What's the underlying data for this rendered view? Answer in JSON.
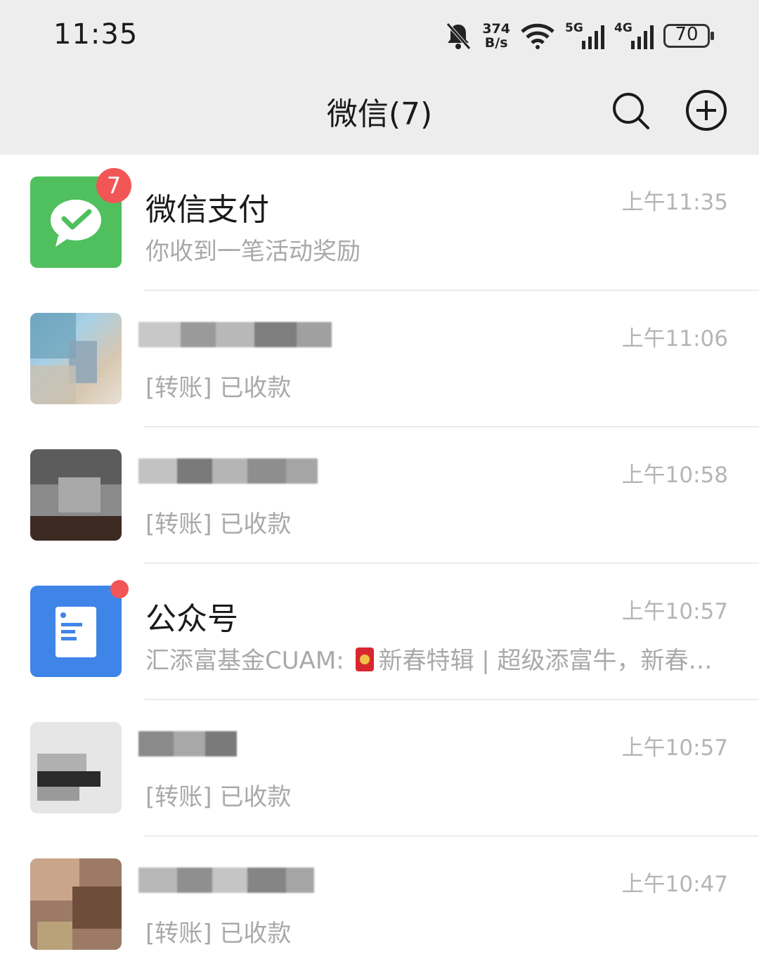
{
  "status_bar": {
    "time": "11:35",
    "speed_value": "374",
    "speed_unit": "B/s",
    "signal1_tag": "5G",
    "signal2_tag": "4G",
    "battery": "70"
  },
  "header": {
    "title": "微信(7)",
    "search_icon": "search-icon",
    "add_icon": "plus-circle-icon"
  },
  "chats": [
    {
      "name": "微信支付",
      "message": "你收到一笔活动奖励",
      "time": "上午11:35",
      "badge": "7",
      "avatar_color": "#4fc05d"
    },
    {
      "name": "",
      "message": "[转账] 已收款",
      "time": "上午11:06"
    },
    {
      "name": "",
      "message": "[转账] 已收款",
      "time": "上午10:58"
    },
    {
      "name": "公众号",
      "message_prefix": "汇添富基金CUAM: ",
      "message_suffix": "新春特辑 | 超级添富牛，新春…",
      "time": "上午10:57",
      "avatar_color": "#3f85e8"
    },
    {
      "name": "",
      "message": "[转账] 已收款",
      "time": "上午10:57"
    },
    {
      "name": "",
      "message": "[转账] 已收款",
      "time": "上午10:47"
    }
  ],
  "colors": {
    "unread_badge": "#f25555",
    "wechat_pay_green": "#4fc05d",
    "official_accounts_blue": "#3f85e8"
  }
}
